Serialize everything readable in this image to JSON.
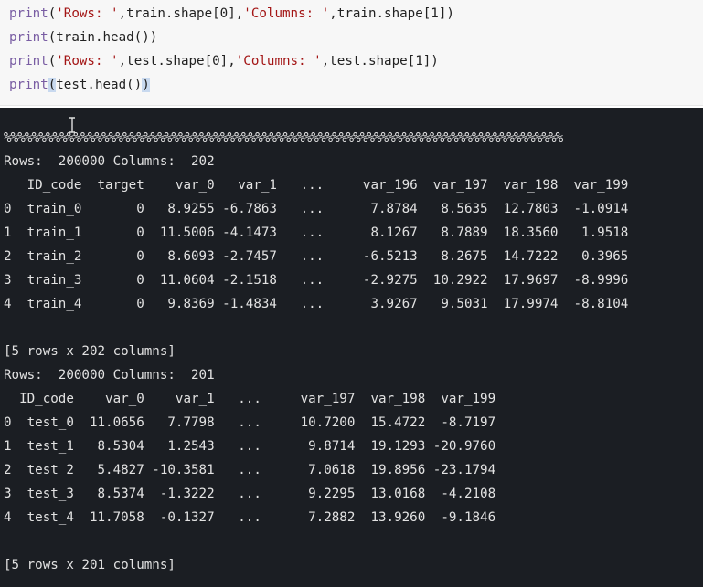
{
  "code": {
    "lines": [
      {
        "fn": "print",
        "text": "(",
        "parts": [
          {
            "t": "str",
            "v": "'Rows: '"
          },
          {
            "t": "txt",
            "v": ",train.shape[0],"
          },
          {
            "t": "str",
            "v": "'Columns: '"
          },
          {
            "t": "txt",
            "v": ",train.shape[1])"
          }
        ]
      },
      {
        "fn": "print",
        "text": "(train.head())"
      },
      {
        "fn": "print",
        "text": "(",
        "parts": [
          {
            "t": "str",
            "v": "'Rows: '"
          },
          {
            "t": "txt",
            "v": ",test.shape[0],"
          },
          {
            "t": "str",
            "v": "'Columns: '"
          },
          {
            "t": "txt",
            "v": ",test.shape[1])"
          }
        ]
      },
      {
        "fn": "print",
        "text": "(test.head())"
      }
    ]
  },
  "output": {
    "progress": "%%%%%%%%%%%%%%%%%%%%%%%%%%%%%%%%%%%%%%%%%%%%%%%%%%%%%%%%%%%%%%%%%%%%%%%%%%%%%%%%",
    "train_shape": "Rows:  200000 Columns:  202",
    "train_header": "   ID_code  target    var_0   var_1   ...     var_196  var_197  var_198  var_199",
    "train_rows": [
      "0  train_0       0   8.9255 -6.7863   ...      7.8784   8.5635  12.7803  -1.0914",
      "1  train_1       0  11.5006 -4.1473   ...      8.1267   8.7889  18.3560   1.9518",
      "2  train_2       0   8.6093 -2.7457   ...     -6.5213   8.2675  14.7222   0.3965",
      "3  train_3       0  11.0604 -2.1518   ...     -2.9275  10.2922  17.9697  -8.9996",
      "4  train_4       0   9.8369 -1.4834   ...      3.9267   9.5031  17.9974  -8.8104"
    ],
    "train_footer": "[5 rows x 202 columns]",
    "test_shape": "Rows:  200000 Columns:  201",
    "test_header": "  ID_code    var_0    var_1   ...     var_197  var_198  var_199",
    "test_rows": [
      "0  test_0  11.0656   7.7798   ...     10.7200  15.4722  -8.7197",
      "1  test_1   8.5304   1.2543   ...      9.8714  19.1293 -20.9760",
      "2  test_2   5.4827 -10.3581   ...      7.0618  19.8956 -23.1794",
      "3  test_3   8.5374  -1.3222   ...      9.2295  13.0168  -4.2108",
      "4  test_4  11.7058  -0.1327   ...      7.2882  13.9260  -9.1846"
    ],
    "test_footer": "[5 rows x 201 columns]"
  }
}
